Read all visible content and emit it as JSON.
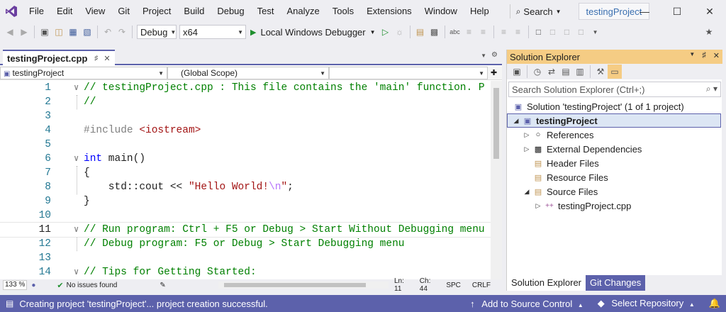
{
  "menu": {
    "items": [
      "File",
      "Edit",
      "View",
      "Git",
      "Project",
      "Build",
      "Debug",
      "Test",
      "Analyze",
      "Tools",
      "Extensions",
      "Window",
      "Help"
    ],
    "search_label": "Search",
    "project_title": "testingProject"
  },
  "toolbar": {
    "config": "Debug",
    "platform": "x64",
    "run_label": "Local Windows Debugger"
  },
  "editor": {
    "tab_label": "testingProject.cpp",
    "nav_project": "testingProject",
    "nav_scope": "(Global Scope)",
    "lines": [
      {
        "n": "1",
        "parts": [
          [
            "cmt",
            "// testingProject.cpp : This file contains the 'main' function. P"
          ]
        ]
      },
      {
        "n": "2",
        "parts": [
          [
            "cmt",
            "//"
          ]
        ]
      },
      {
        "n": "3",
        "parts": []
      },
      {
        "n": "4",
        "parts": [
          [
            "pp",
            "#include "
          ],
          [
            "str",
            "<iostream>"
          ]
        ]
      },
      {
        "n": "5",
        "parts": []
      },
      {
        "n": "6",
        "parts": [
          [
            "kw",
            "int"
          ],
          [
            "plain",
            " main()"
          ]
        ]
      },
      {
        "n": "7",
        "parts": [
          [
            "plain",
            "{"
          ]
        ]
      },
      {
        "n": "8",
        "parts": [
          [
            "plain",
            "    std::cout << "
          ],
          [
            "str",
            "\"Hello World!"
          ],
          [
            "esc",
            "\\n"
          ],
          [
            "str",
            "\""
          ],
          [
            "plain",
            ";"
          ]
        ]
      },
      {
        "n": "9",
        "parts": [
          [
            "plain",
            "}"
          ]
        ]
      },
      {
        "n": "10",
        "parts": []
      },
      {
        "n": "11",
        "parts": [
          [
            "cmt",
            "// Run program: Ctrl + F5 or Debug > Start Without Debugging menu"
          ]
        ]
      },
      {
        "n": "12",
        "parts": [
          [
            "cmt",
            "// Debug program: F5 or Debug > Start Debugging menu"
          ]
        ]
      },
      {
        "n": "13",
        "parts": []
      },
      {
        "n": "14",
        "parts": [
          [
            "cmt",
            "// Tips for Getting Started:"
          ]
        ]
      }
    ],
    "zoom": "133 %",
    "issues": "No issues found",
    "ln": "Ln: 11",
    "ch": "Ch: 44",
    "spc": "SPC",
    "crlf": "CRLF"
  },
  "solution": {
    "title": "Solution Explorer",
    "search_placeholder": "Search Solution Explorer (Ctrl+;)",
    "items": [
      "Solution 'testingProject' (1 of 1 project)",
      "testingProject",
      "References",
      "External Dependencies",
      "Header Files",
      "Resource Files",
      "Source Files",
      "testingProject.cpp"
    ],
    "tab_active": "Solution Explorer",
    "tab_inactive": "Git Changes"
  },
  "status": {
    "message": "Creating project 'testingProject'... project creation successful.",
    "source_control": "Add to Source Control",
    "repository": "Select Repository"
  },
  "colors": {
    "accent": "#5c61ab",
    "panel_title": "#f5cc84"
  }
}
